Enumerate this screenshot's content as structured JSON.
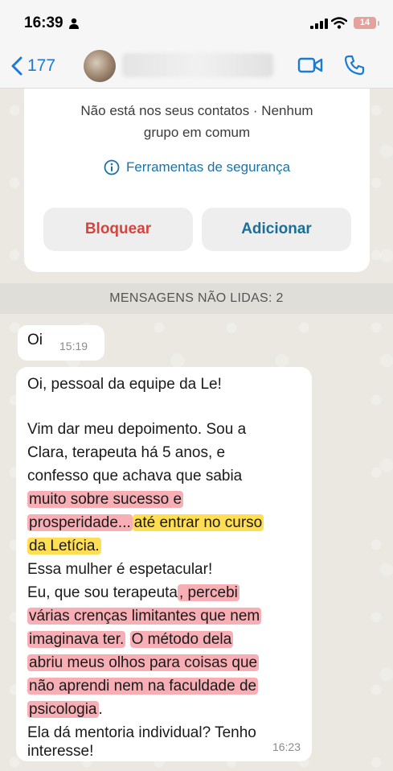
{
  "status_bar": {
    "time": "16:39",
    "battery": "14"
  },
  "header": {
    "back_count": "177"
  },
  "contact_card": {
    "note_line1": "Não está nos seus contatos · Nenhum",
    "note_line2": "grupo em comum",
    "safety_label": "Ferramentas de segurança",
    "block_label": "Bloquear",
    "add_label": "Adicionar"
  },
  "unread_banner": "MENSAGENS NÃO LIDAS: 2",
  "messages": [
    {
      "text": "Oi",
      "time": "15:19"
    },
    {
      "time": "16:23",
      "lines": {
        "l1": "Oi, pessoal da equipe da Le!",
        "l2": "Vim dar meu depoimento. Sou a",
        "l3": "Clara, terapeuta há 5 anos, e",
        "l4": "confesso que achava que sabia",
        "l5": "muito sobre sucesso e",
        "l6a": "prosperidade...",
        "l6b": "até entrar no curso",
        "l7": "da Letícia.",
        "l8": "Essa mulher é espetacular!",
        "l9a": "Eu, que sou terapeuta",
        "l9b": ", percebi",
        "l10": "várias crenças limitantes que nem",
        "l11a": "imaginava ter.",
        "l11b": "O método dela",
        "l12": "abriu meus olhos para coisas que",
        "l13": "não aprendi nem na faculdade de",
        "l14": "psicologia",
        "l14b": ".",
        "l15": "Ela dá mentoria individual? Tenho",
        "l16": "interesse!"
      }
    }
  ],
  "colors": {
    "accent": "#1b7bd4",
    "block": "#d6453d",
    "add": "#1a6f97",
    "highlight_pink": "#f06e78",
    "highlight_yellow": "#ffd628"
  }
}
